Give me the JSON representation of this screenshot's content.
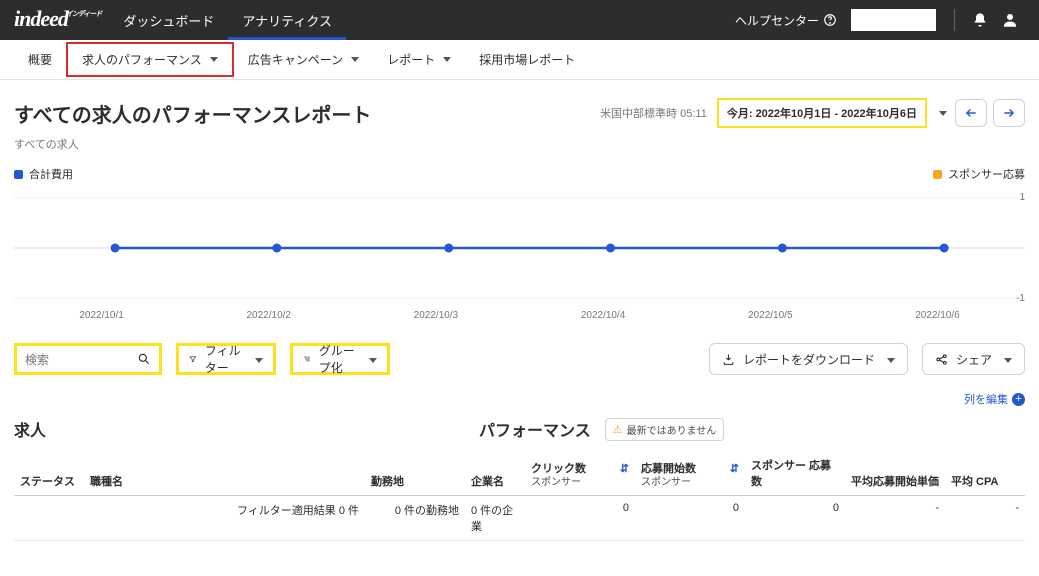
{
  "topnav": {
    "logo": "indeed",
    "logo_ruby": "インディード",
    "links": [
      "ダッシュボード",
      "アナリティクス"
    ],
    "help": "ヘルプセンター"
  },
  "subnav": {
    "items": [
      "概要",
      "求人のパフォーマンス",
      "広告キャンペーン",
      "レポート",
      "採用市場レポート"
    ]
  },
  "header": {
    "title": "すべての求人のパフォーマンスレポート",
    "subtitle": "すべての求人",
    "timezone": "米国中部標準時 05:11",
    "date_range": "今月: 2022年10月1日 - 2022年10月6日"
  },
  "legend": {
    "left": {
      "label": "合計費用",
      "color": "#2557cf"
    },
    "right": {
      "label": "スポンサー応募",
      "color": "#f5a623"
    }
  },
  "chart_data": {
    "type": "line",
    "categories": [
      "2022/10/1",
      "2022/10/2",
      "2022/10/3",
      "2022/10/4",
      "2022/10/5",
      "2022/10/6"
    ],
    "series": [
      {
        "name": "合計費用",
        "color": "#2557cf",
        "values": [
          0,
          0,
          0,
          0,
          0,
          0
        ]
      }
    ],
    "ylim": [
      -1,
      1
    ],
    "yticks": [
      1,
      -1
    ]
  },
  "toolbar": {
    "search_placeholder": "検索",
    "filter": "フィルター",
    "group": "グループ化",
    "download": "レポートをダウンロード",
    "share": "シェア"
  },
  "cols_edit": "列を編集",
  "sections": {
    "jobs": "求人",
    "perf": "パフォーマンス",
    "warn": "最新ではありません"
  },
  "columns": {
    "status": "ステータス",
    "name": "職種名",
    "loc": "勤務地",
    "company": "企業名",
    "clicks_top": "クリック数",
    "clicks_sub": "スポンサー",
    "apps_top": "応募開始数",
    "apps_sub": "スポンサー",
    "sponsor_apps": "スポンサー 応募数",
    "avg_start_price": "平均応募開始単価",
    "avg_cpa": "平均 CPA"
  },
  "summary_row": {
    "filter_result": "フィルター適用結果 0 件",
    "locations": "0 件の勤務地",
    "companies": "0 件の企業",
    "clicks": "0",
    "apps": "0",
    "sponsor_apps": "0",
    "avg_start_price": "-",
    "avg_cpa": "-"
  }
}
